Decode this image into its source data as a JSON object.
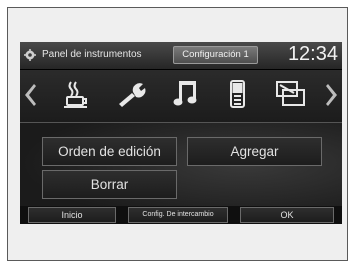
{
  "header": {
    "title": "Panel de instrumentos",
    "tab": "Configuración 1",
    "clock": "12:34"
  },
  "icons": [
    "coffee-cup-icon",
    "wrench-icon",
    "music-note-icon",
    "phone-icon",
    "display-screen-icon"
  ],
  "buttons": {
    "edit_order": "Orden de edición",
    "add": "Agregar",
    "delete": "Borrar"
  },
  "bottom_bar": {
    "home": "Inicio",
    "swap_config": "Config. De intercambio",
    "ok": "OK"
  }
}
